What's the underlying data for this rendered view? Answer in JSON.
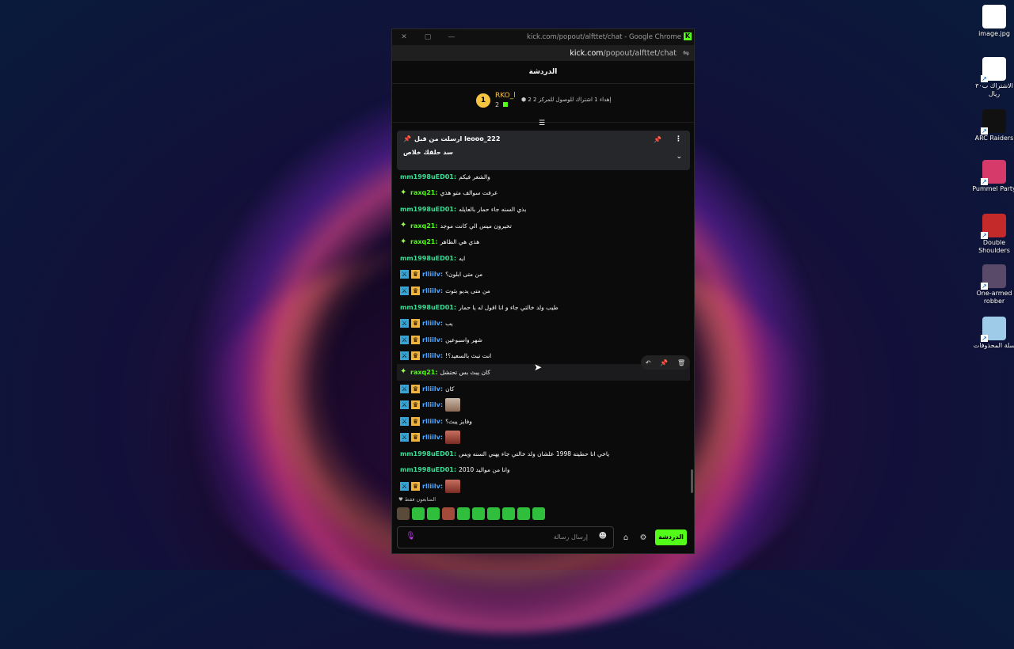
{
  "desktop_icons": [
    {
      "label": "image.jpg",
      "icon": "chrome-file-icon",
      "color": "#ffffff"
    },
    {
      "label": "الاشتراك ب٣٠ ريال",
      "icon": "document-icon",
      "color": "#ffffff"
    },
    {
      "label": "ARC Raiders",
      "icon": "arc-raiders-icon",
      "color": "#111111"
    },
    {
      "label": "Pummel Party",
      "icon": "pummel-party-icon",
      "color": "#d63a6a"
    },
    {
      "label": "Double Shoulders",
      "icon": "ds-logo-icon",
      "color": "#c52a2a"
    },
    {
      "label": "One-armed robber",
      "icon": "oar-icon",
      "color": "#5a4a6a"
    },
    {
      "label": "سلة المحذوفات",
      "icon": "recycle-bin-icon",
      "color": "#9ecbe8"
    }
  ],
  "window": {
    "title": "kick.com/popout/alfttet/chat - Google Chrome",
    "url_host": "kick.com",
    "url_path": "/popout/alfttet/chat",
    "controls": {
      "close": "✕",
      "restore": "▢",
      "minimize": "—"
    }
  },
  "chat": {
    "header": "الدردشة",
    "gift": {
      "rank": "1",
      "user": "RKO_l",
      "count": "2",
      "info": "إهداء 1 اشتراك للوصول للمركز 2"
    },
    "pinned": {
      "by": "ارسلت من قبل leooo_222",
      "message": "سد حلقك خلاص"
    },
    "messages": [
      {
        "user": "mm1998uED01",
        "text": "والشعر فيكم",
        "badges": [],
        "ucolor": "teal",
        "emote": ""
      },
      {
        "user": "raxq21",
        "text": "عرفت سوالف متو هذي",
        "badges": [
          "star"
        ],
        "ucolor": "green",
        "emote": ""
      },
      {
        "user": "mm1998uED01",
        "text": "بذي السنه جاء حمار بالعايله",
        "badges": [],
        "ucolor": "teal",
        "emote": ""
      },
      {
        "user": "raxq21",
        "text": "تخيرون ميس الي كانت موجد",
        "badges": [
          "star"
        ],
        "ucolor": "green",
        "emote": ""
      },
      {
        "user": "raxq21",
        "text": "هذي هي الظاهر",
        "badges": [
          "star"
        ],
        "ucolor": "green",
        "emote": ""
      },
      {
        "user": "mm1998uED01",
        "text": "ايه",
        "badges": [],
        "ucolor": "teal",
        "emote": ""
      },
      {
        "user": "rlliilv",
        "text": "من متى ابلون؟",
        "badges": [
          "mod",
          "crown"
        ],
        "ucolor": "blue",
        "emote": ""
      },
      {
        "user": "rlliilv",
        "text": "من متى يديو بثوث",
        "badges": [
          "mod",
          "crown"
        ],
        "ucolor": "blue",
        "emote": ""
      },
      {
        "user": "mm1998uED01",
        "text": "طيب ولد خالتي جاء و انا اقول له يا حمار",
        "badges": [],
        "ucolor": "teal",
        "emote": ""
      },
      {
        "user": "rlliilv",
        "text": "يب",
        "badges": [
          "mod",
          "crown"
        ],
        "ucolor": "blue",
        "emote": ""
      },
      {
        "user": "rlliilv",
        "text": "شهر واسبوعين",
        "badges": [
          "mod",
          "crown"
        ],
        "ucolor": "blue",
        "emote": ""
      },
      {
        "user": "rlliilv",
        "text": "!انت تبث بالسعيد؟",
        "badges": [
          "mod",
          "crown"
        ],
        "ucolor": "blue",
        "emote": ""
      },
      {
        "user": "raxq21",
        "text": "كان يبث بس تحتشل",
        "badges": [
          "star"
        ],
        "ucolor": "green",
        "emote": "",
        "hover": true
      },
      {
        "user": "rlliilv",
        "text": "كان",
        "badges": [
          "mod",
          "crown"
        ],
        "ucolor": "blue",
        "emote": ""
      },
      {
        "user": "rlliilv",
        "text": "",
        "badges": [
          "mod",
          "crown"
        ],
        "ucolor": "blue",
        "emote": "face"
      },
      {
        "user": "rlliilv",
        "text": "وفايز يبث؟",
        "badges": [
          "mod",
          "crown"
        ],
        "ucolor": "blue",
        "emote": ""
      },
      {
        "user": "rlliilv",
        "text": "",
        "badges": [
          "mod",
          "crown"
        ],
        "ucolor": "blue",
        "emote": "red"
      },
      {
        "user": "mm1998uED01",
        "text": "ياخي انا حطيته 1998 علشان ولد خالتي جاء يهني السنه ويس",
        "badges": [],
        "ucolor": "teal",
        "emote": ""
      },
      {
        "user": "mm1998uED01",
        "text": "وانا من مواليد 2010",
        "badges": [],
        "ucolor": "teal",
        "emote": ""
      },
      {
        "user": "rlliilv",
        "text": "",
        "badges": [
          "mod",
          "crown"
        ],
        "ucolor": "blue",
        "emote": "red"
      }
    ],
    "emote_strip_label": "المتابعون فقط",
    "input_placeholder": "إرسال رسالة",
    "send_label": "الدردشة"
  }
}
